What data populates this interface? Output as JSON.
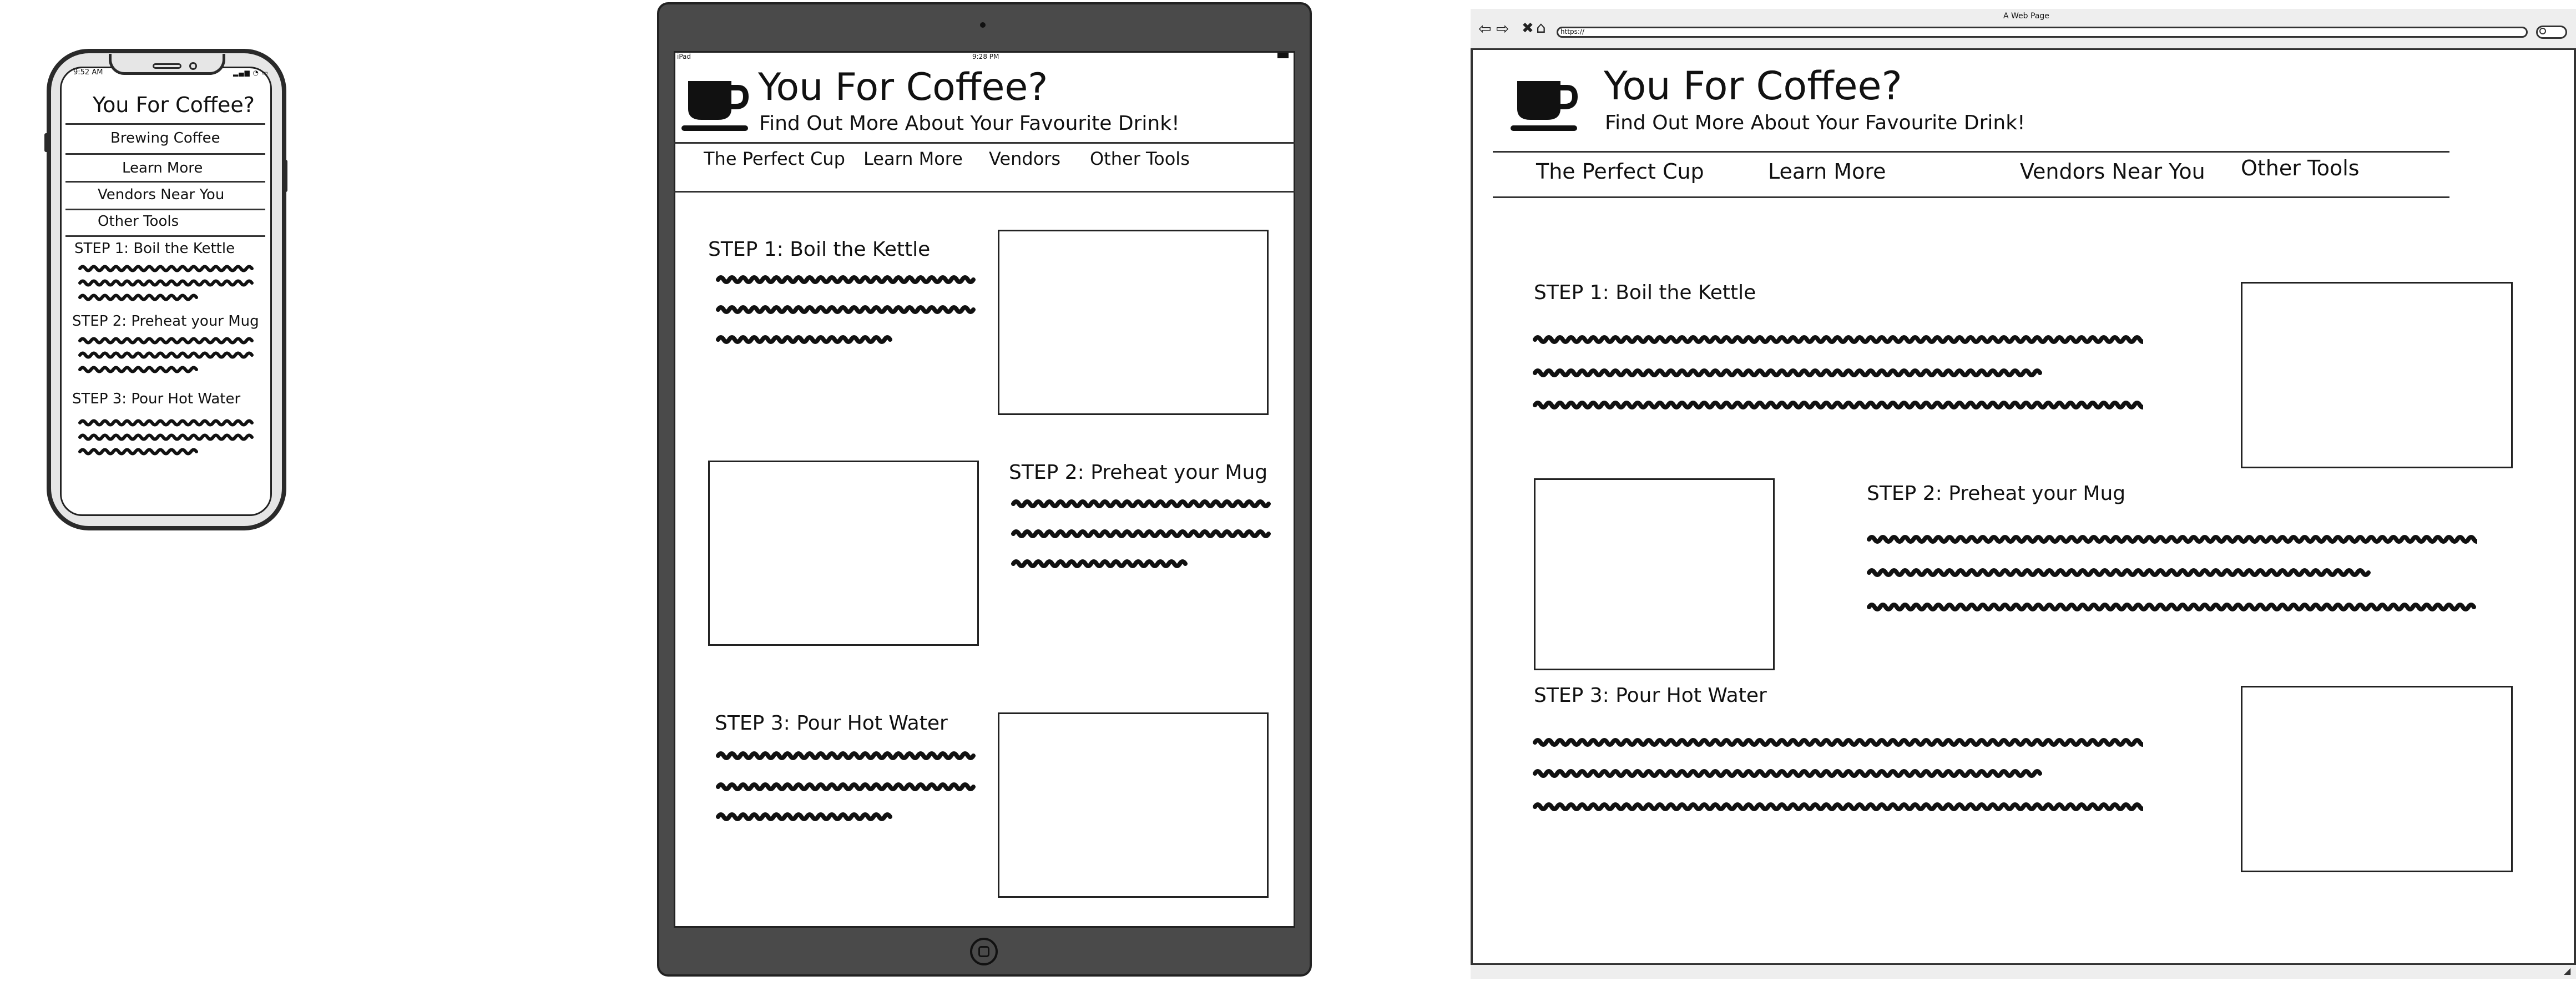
{
  "brand": {
    "title": "You For Coffee?",
    "tagline": "Find Out More About Your Favourite Drink!"
  },
  "phone": {
    "status": {
      "time": "9:52 AM"
    },
    "nav": [
      "Brewing Coffee",
      "Learn More",
      "Vendors Near You",
      "Other Tools"
    ]
  },
  "tablet": {
    "status": {
      "carrier": "iPad",
      "time": "9:28 PM"
    },
    "nav": [
      "The Perfect Cup",
      "Learn More",
      "Vendors",
      "Other Tools"
    ]
  },
  "browser": {
    "window_title": "A Web Page",
    "url": "https://",
    "nav": [
      "The Perfect Cup",
      "Learn More",
      "Vendors Near You",
      "Other Tools"
    ]
  },
  "steps": [
    {
      "title": "STEP 1: Boil the Kettle"
    },
    {
      "title": "STEP 2: Preheat your Mug"
    },
    {
      "title": "STEP 3: Pour Hot Water"
    }
  ],
  "icons": {
    "brand": "coffee-cup-icon",
    "back": "arrow-left-icon",
    "forward": "arrow-right-icon",
    "stop": "close-icon",
    "home": "home-icon",
    "search": "search-icon",
    "resize": "resize-grip-icon"
  }
}
